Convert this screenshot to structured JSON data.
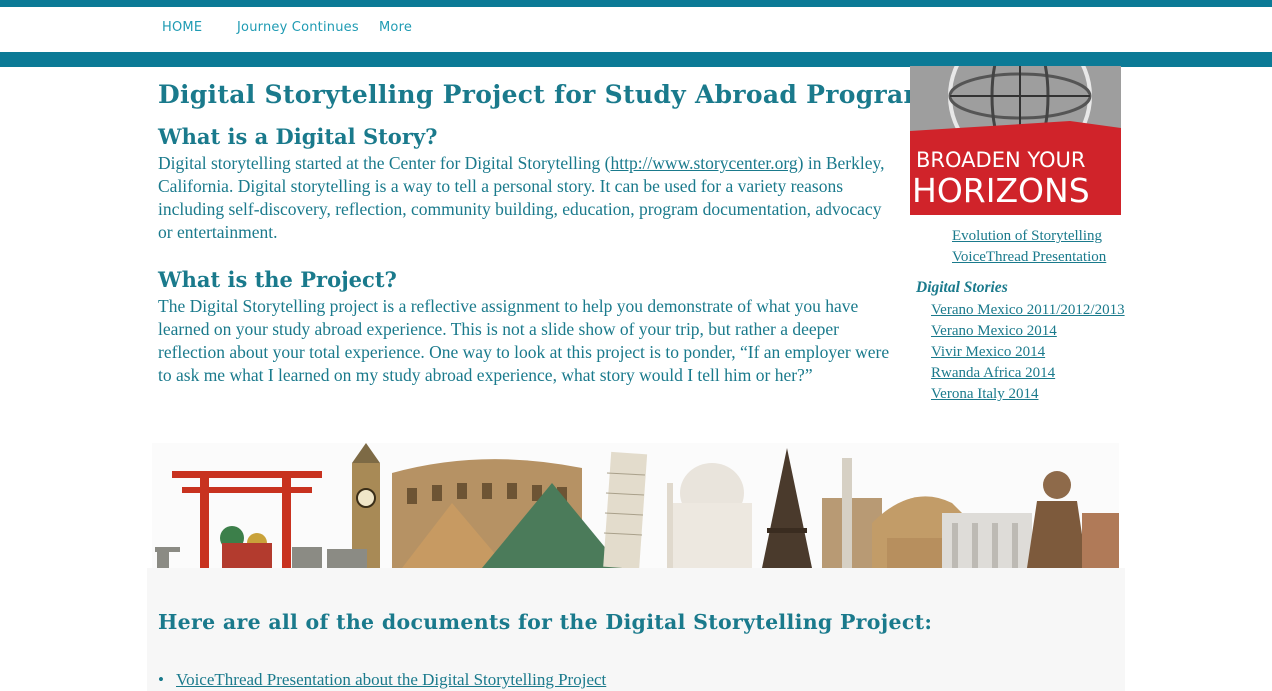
{
  "nav": {
    "items": [
      "HOME",
      "Journey Continues",
      "More"
    ]
  },
  "main": {
    "title": "Digital Storytelling Project for  Study Abroad Programs",
    "section1_heading": "What is a Digital Story?",
    "section1_text_before_link": "Digital storytelling started at the Center for Digital Storytelling (",
    "section1_link": "http://www.storycenter.org",
    "section1_text_after_link": ") in Berkley, California. Digital storytelling is a way to tell a personal story. It can be used for a variety reasons including self-discovery, reflection, community building, education, program documentation, advocacy or entertainment.",
    "section2_heading": "What is the Project?",
    "section2_text": "The Digital Storytelling project is a reflective assignment to help you demonstrate of what you have learned on your study abroad experience. This is not a slide show of your trip, but rather a deeper reflection about your total experience. One way to look at this project is to ponder, “If an employer were to ask me what I learned on my study abroad experience, what story would I tell him or her?”"
  },
  "sidebar": {
    "hero_text_line1": "BROADEN YOUR",
    "hero_text_line2": "HORIZONS",
    "links": [
      "Evolution of Storytelling",
      "VoiceThread Presentation"
    ],
    "stories_title": "Digital Stories",
    "stories": [
      "Verano Mexico 2011/2012/2013",
      "Verano Mexico 2014",
      "Vivir Mexico 2014",
      "Rwanda Africa 2014",
      "Verona Italy 2014"
    ]
  },
  "documents": {
    "heading": "Here are all of the documents for the Digital Storytelling Project:",
    "items": [
      "VoiceThread Presentation about the Digital Storytelling Project "
    ]
  },
  "colors": {
    "brand_teal": "#0b7a96",
    "text_teal": "#1a7a8c",
    "nav_link": "#1f9bb3",
    "hero_red": "#d0232a"
  }
}
